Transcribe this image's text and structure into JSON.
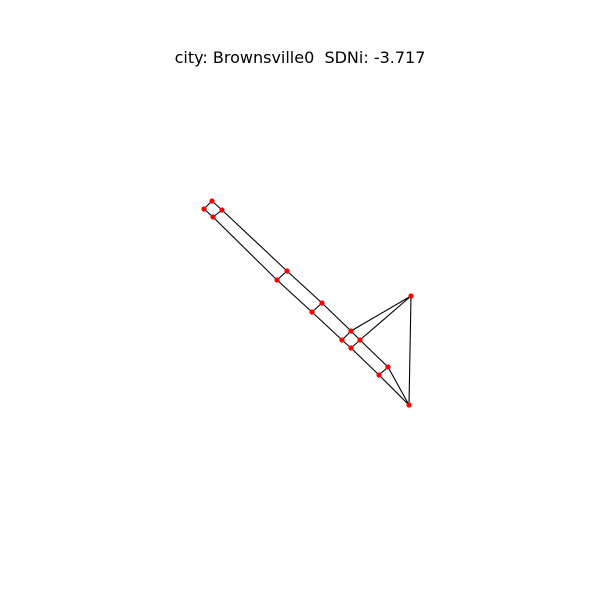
{
  "figure": {
    "title": "city: Brownsville0  SDNi: -3.717"
  },
  "colors": {
    "node": "#ff0000",
    "edge": "#000000",
    "background": "#ffffff"
  },
  "graph": {
    "nodes": [
      {
        "id": "n0"
      },
      {
        "id": "n1"
      },
      {
        "id": "n2"
      },
      {
        "id": "n3"
      },
      {
        "id": "n4"
      },
      {
        "id": "n5"
      },
      {
        "id": "n6"
      },
      {
        "id": "n7"
      },
      {
        "id": "n8"
      },
      {
        "id": "n9"
      },
      {
        "id": "n10"
      },
      {
        "id": "n11"
      },
      {
        "id": "n12"
      },
      {
        "id": "n13"
      },
      {
        "id": "n14"
      },
      {
        "id": "n15"
      }
    ],
    "edges": [
      [
        "n0",
        "n1"
      ],
      [
        "n1",
        "n3"
      ],
      [
        "n3",
        "n2"
      ],
      [
        "n2",
        "n0"
      ],
      [
        "n2",
        "n4"
      ],
      [
        "n4",
        "n6"
      ],
      [
        "n6",
        "n8"
      ],
      [
        "n8",
        "n10"
      ],
      [
        "n10",
        "n12"
      ],
      [
        "n12",
        "n14"
      ],
      [
        "n3",
        "n5"
      ],
      [
        "n5",
        "n7"
      ],
      [
        "n7",
        "n9"
      ],
      [
        "n9",
        "n11"
      ],
      [
        "n11",
        "n13"
      ],
      [
        "n13",
        "n15"
      ],
      [
        "n4",
        "n5"
      ],
      [
        "n6",
        "n7"
      ],
      [
        "n8",
        "n9"
      ],
      [
        "n10",
        "n11"
      ],
      [
        "n12",
        "n13"
      ],
      [
        "n14",
        "n15"
      ],
      [
        "n12",
        "n14"
      ],
      [
        "n14",
        "n15"
      ],
      [
        "n13",
        "n15"
      ],
      [
        "n8",
        "n14"
      ],
      [
        "n10",
        "n14"
      ],
      [
        "n15",
        "n14"
      ]
    ]
  }
}
